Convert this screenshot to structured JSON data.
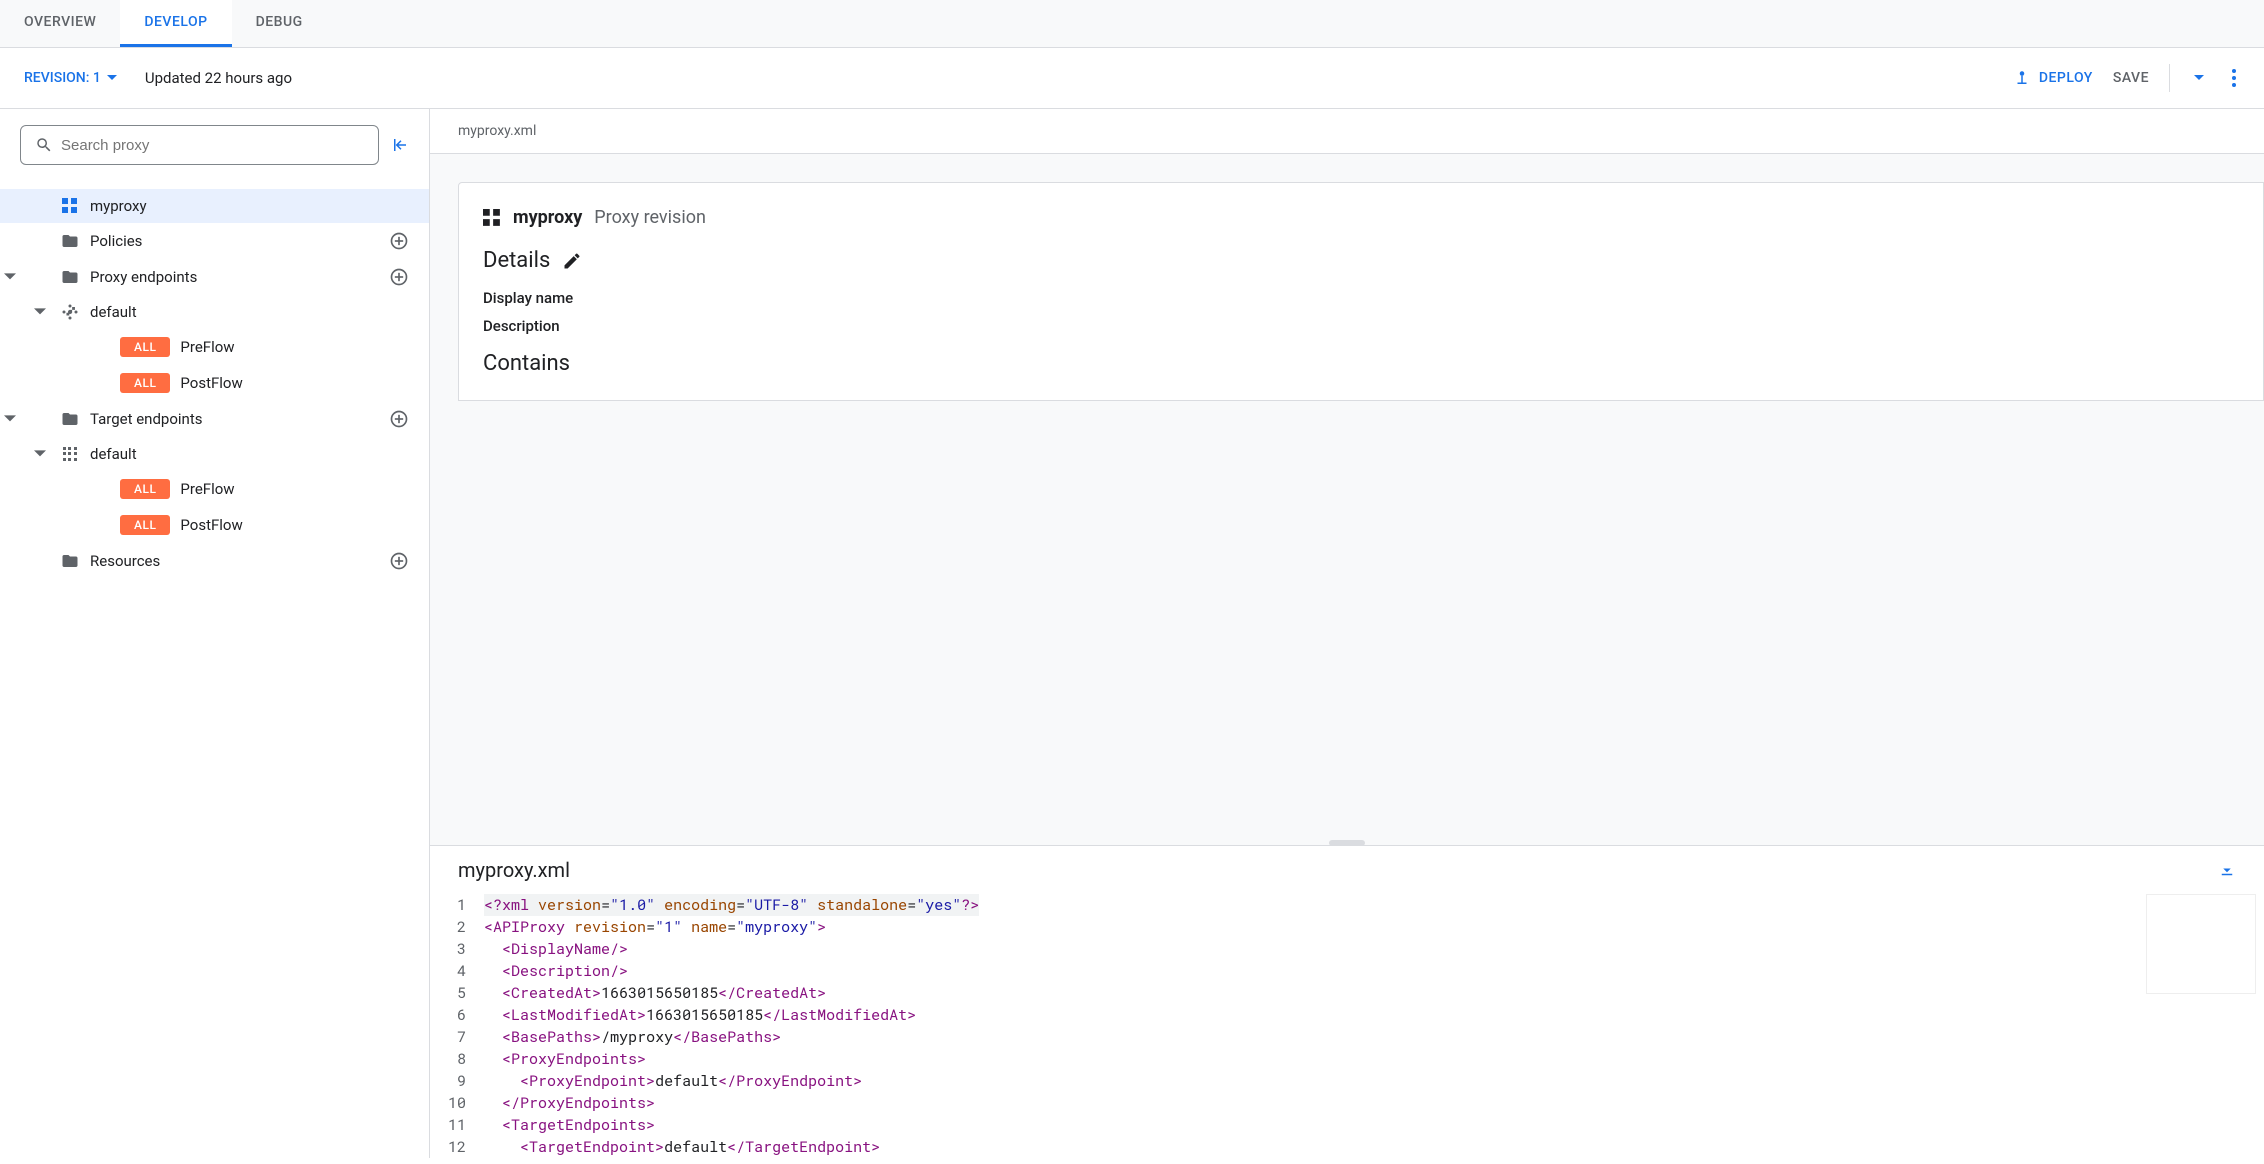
{
  "tabs": {
    "overview": "OVERVIEW",
    "develop": "DEVELOP",
    "debug": "DEBUG"
  },
  "toolbar": {
    "revision": "REVISION: 1",
    "updated": "Updated 22 hours ago",
    "deploy": "DEPLOY",
    "save": "SAVE"
  },
  "search": {
    "placeholder": "Search proxy"
  },
  "tree": {
    "root": "myproxy",
    "policies": "Policies",
    "proxy_endpoints": "Proxy endpoints",
    "pe_default": "default",
    "pe_preflow": "PreFlow",
    "pe_postflow": "PostFlow",
    "target_endpoints": "Target endpoints",
    "te_default": "default",
    "te_preflow": "PreFlow",
    "te_postflow": "PostFlow",
    "resources": "Resources",
    "badge_all": "ALL"
  },
  "main": {
    "breadcrumb": "myproxy.xml",
    "title": "myproxy",
    "subtitle": "Proxy revision",
    "details": "Details",
    "display_name": "Display name",
    "description": "Description",
    "contains": "Contains"
  },
  "editor": {
    "title": "myproxy.xml",
    "xml": {
      "created_at": "1663015650185",
      "last_modified_at": "1663015650185",
      "base_path": "/myproxy",
      "proxy_endpoint": "default",
      "target_endpoint": "default",
      "revision": "1",
      "name": "myproxy",
      "version": "1.0",
      "encoding": "UTF-8",
      "standalone": "yes"
    }
  }
}
